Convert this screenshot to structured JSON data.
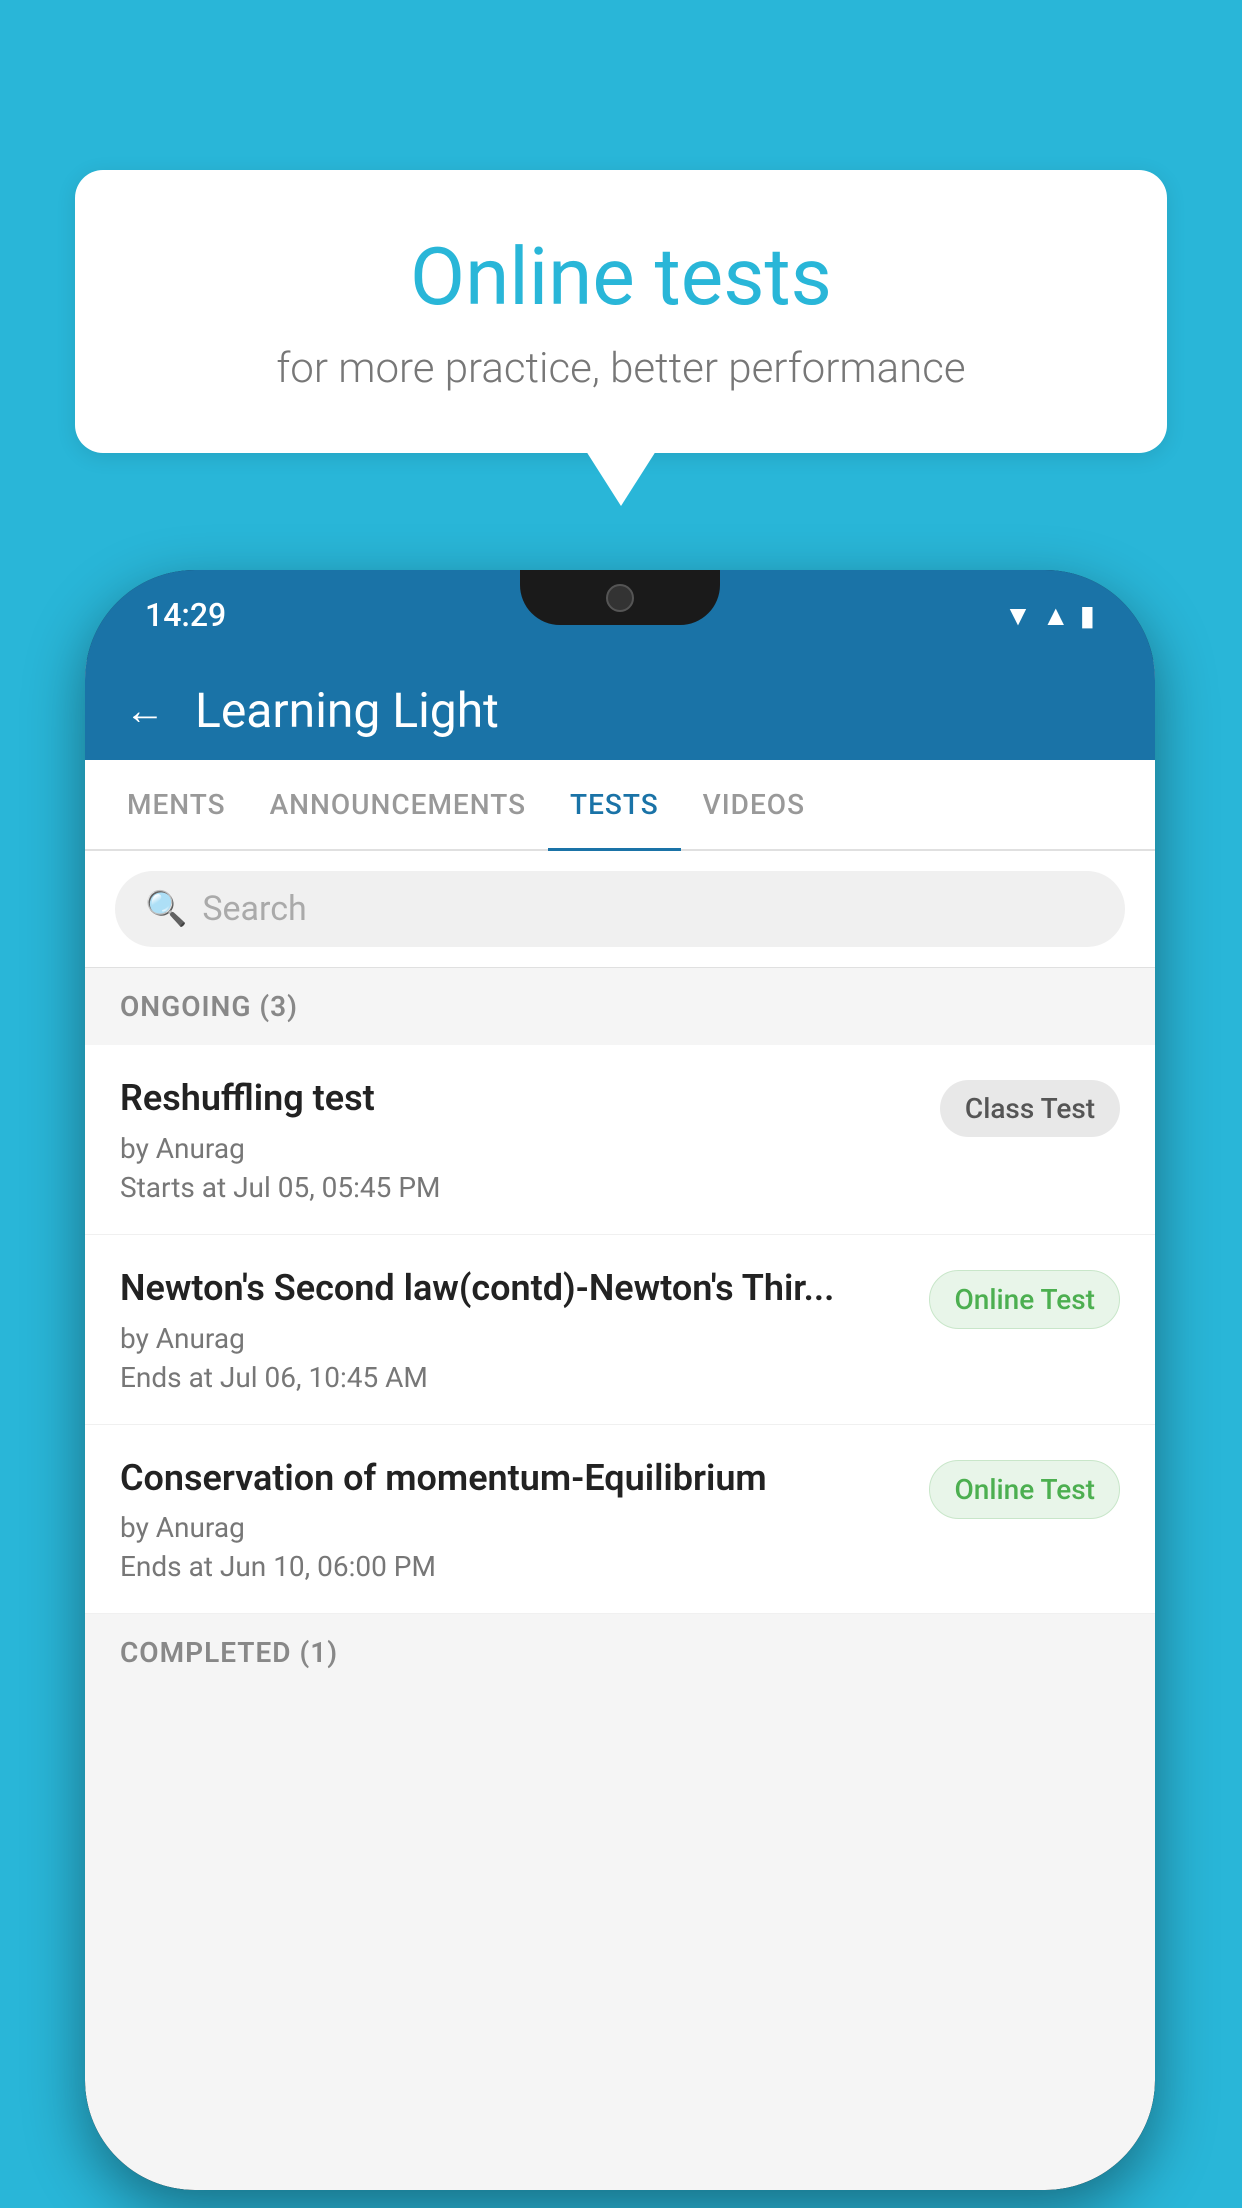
{
  "background": {
    "color": "#29b6d8"
  },
  "speech_bubble": {
    "title": "Online tests",
    "subtitle": "for more practice, better performance"
  },
  "phone": {
    "status_bar": {
      "time": "14:29",
      "icons": [
        "wifi",
        "signal",
        "battery"
      ]
    },
    "header": {
      "back_label": "←",
      "title": "Learning Light"
    },
    "tabs": [
      {
        "label": "MENTS",
        "active": false
      },
      {
        "label": "ANNOUNCEMENTS",
        "active": false
      },
      {
        "label": "TESTS",
        "active": true
      },
      {
        "label": "VIDEOS",
        "active": false
      }
    ],
    "search": {
      "placeholder": "Search"
    },
    "ongoing_section": {
      "label": "ONGOING (3)"
    },
    "tests": [
      {
        "title": "Reshuffling test",
        "author": "by Anurag",
        "time": "Starts at  Jul 05, 05:45 PM",
        "badge": "Class Test",
        "badge_type": "class"
      },
      {
        "title": "Newton's Second law(contd)-Newton's Thir...",
        "author": "by Anurag",
        "time": "Ends at  Jul 06, 10:45 AM",
        "badge": "Online Test",
        "badge_type": "online"
      },
      {
        "title": "Conservation of momentum-Equilibrium",
        "author": "by Anurag",
        "time": "Ends at  Jun 10, 06:00 PM",
        "badge": "Online Test",
        "badge_type": "online"
      }
    ],
    "completed_section": {
      "label": "COMPLETED (1)"
    }
  }
}
